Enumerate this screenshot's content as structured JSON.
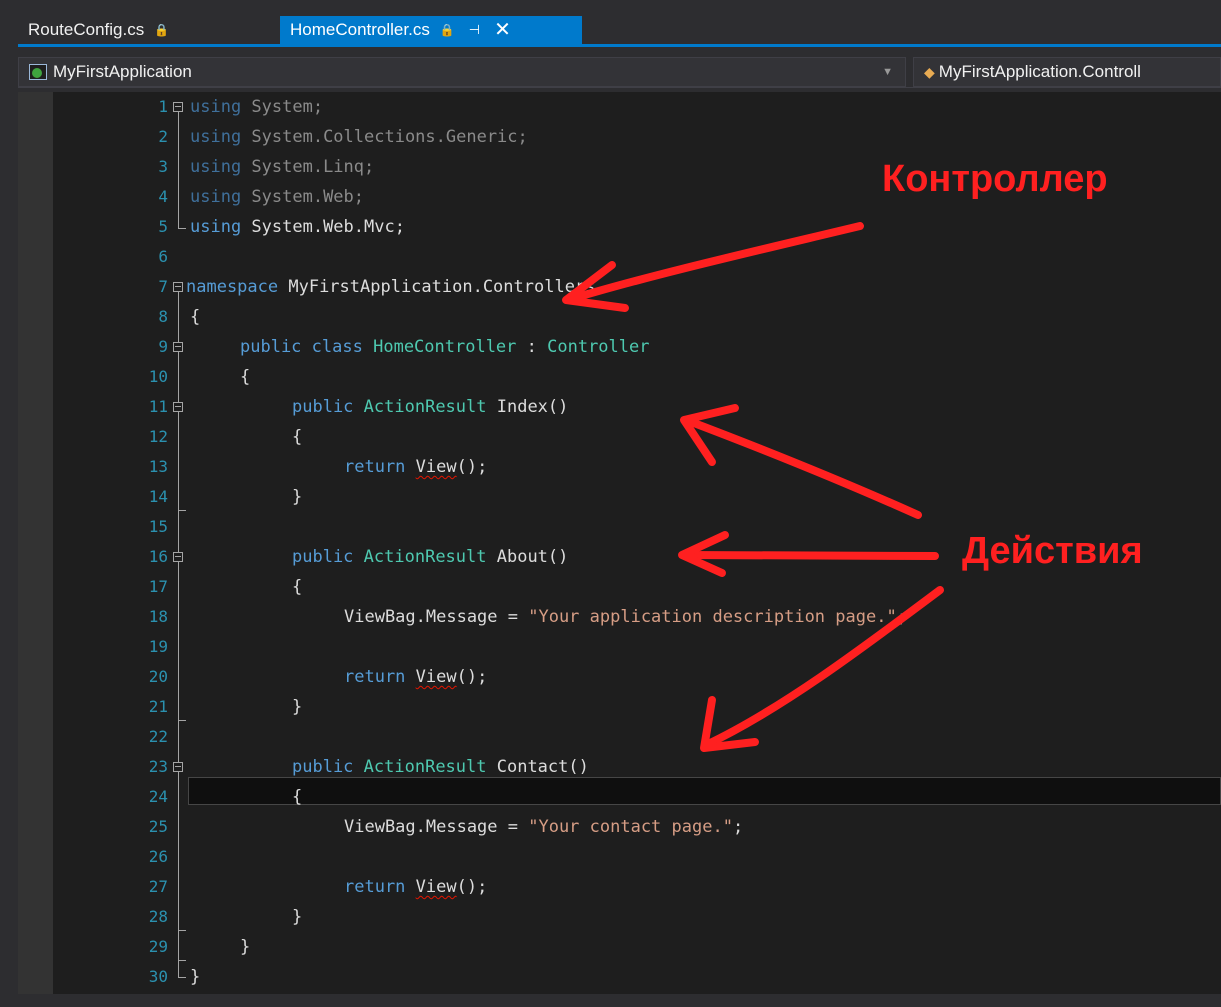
{
  "tabs": [
    {
      "label": "RouteConfig.cs",
      "lock": "🔒",
      "active": false
    },
    {
      "label": "HomeController.cs",
      "lock": "🔒",
      "pin": "⊣",
      "close": "✕",
      "active": true
    }
  ],
  "navbar": {
    "project": "MyFirstApplication",
    "class_scope": "MyFirstApplication.Controll"
  },
  "code_lines": [
    {
      "n": "1"
    },
    {
      "n": "2"
    },
    {
      "n": "3"
    },
    {
      "n": "4"
    },
    {
      "n": "5"
    },
    {
      "n": "6"
    },
    {
      "n": "7"
    },
    {
      "n": "8"
    },
    {
      "n": "9"
    },
    {
      "n": "10"
    },
    {
      "n": "11"
    },
    {
      "n": "12"
    },
    {
      "n": "13"
    },
    {
      "n": "14"
    },
    {
      "n": "15"
    },
    {
      "n": "16"
    },
    {
      "n": "17"
    },
    {
      "n": "18"
    },
    {
      "n": "19"
    },
    {
      "n": "20"
    },
    {
      "n": "21"
    },
    {
      "n": "22"
    },
    {
      "n": "23"
    },
    {
      "n": "24"
    },
    {
      "n": "25"
    },
    {
      "n": "26"
    },
    {
      "n": "27"
    },
    {
      "n": "28"
    },
    {
      "n": "29"
    },
    {
      "n": "30"
    }
  ],
  "code": {
    "l1_kw": "using",
    "l1_rest": " System;",
    "l2_kw": "using",
    "l2_rest": " System.Collections.Generic;",
    "l3_kw": "using",
    "l3_rest": " System.Linq;",
    "l4_kw": "using",
    "l4_rest": " System.Web;",
    "l5_kw": "using",
    "l5_rest": " System.Web.Mvc;",
    "l7_kw": "namespace",
    "l7_rest": " MyFirstApplication.Controllers",
    "open_brace": "{",
    "close_brace": "}",
    "public": "public",
    "class": "class",
    "class_name": "HomeController",
    "colon": " : ",
    "base_class": "Controller",
    "action_result": "ActionResult",
    "index": " Index()",
    "about": " About()",
    "contact": " Contact()",
    "return": "return",
    "view": "View",
    "call_end": "();",
    "viewbag": "ViewBag.Message = ",
    "about_msg": "\"Your application description page.\"",
    "contact_msg": "\"Your contact page.\"",
    "semicolon": ";"
  },
  "annotations": {
    "controller": "Контроллер",
    "actions": "Действия"
  },
  "colors": {
    "accent": "#007acc",
    "annotation": "#ff2020"
  }
}
